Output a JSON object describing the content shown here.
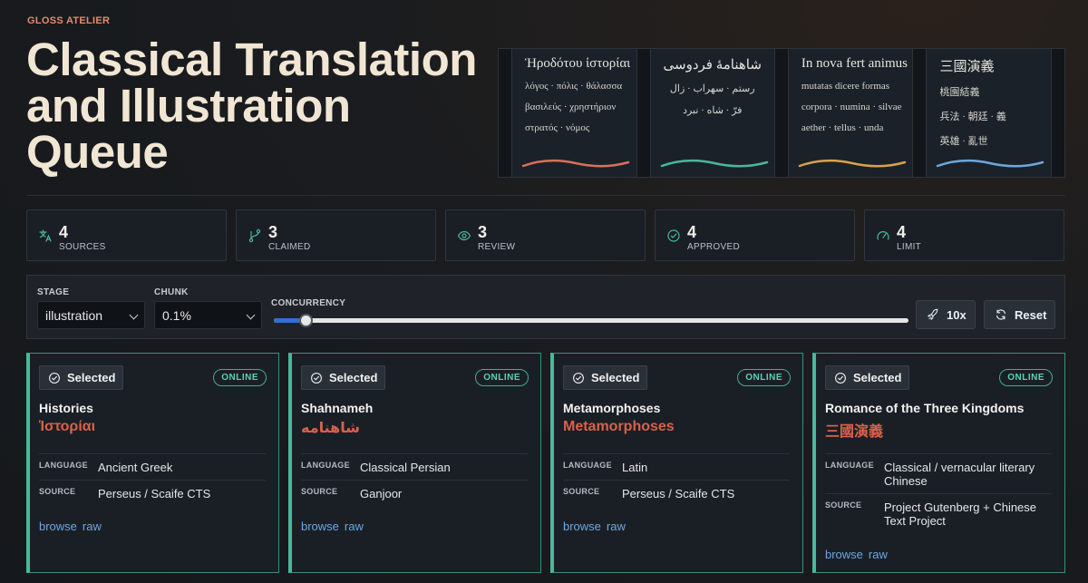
{
  "brand": "GLOSS ATELIER",
  "title": "Classical Translation and Illustration Queue",
  "hero_books": [
    {
      "title": "Ἡροδότου ἱστορίαι",
      "lines": [
        "λόγος · πόλις · θάλασσα",
        "βασιλεύς · χρηστήριον",
        "στρατός · νόμος"
      ],
      "color": "#d9705a",
      "rtl": false
    },
    {
      "title": "شاهنامهٔ فردوسی",
      "lines": [
        "رستم · سهراب · زال",
        "فرّ · شاه · نبرد"
      ],
      "color": "#4ab89a",
      "rtl": true
    },
    {
      "title": "In nova fert animus",
      "lines": [
        "mutatas dicere formas",
        "corpora · numina · silvae",
        "aether · tellus · unda"
      ],
      "color": "#d9a24a",
      "rtl": false
    },
    {
      "title": "三國演義",
      "lines": [
        "桃園結義",
        "兵法 · 朝廷 · 義",
        "英雄 · 亂世"
      ],
      "color": "#6ea7df",
      "rtl": false
    }
  ],
  "stats": [
    {
      "value": "4",
      "label": "SOURCES",
      "icon": "translate-icon"
    },
    {
      "value": "3",
      "label": "CLAIMED",
      "icon": "branch-icon"
    },
    {
      "value": "3",
      "label": "REVIEW",
      "icon": "eye-icon"
    },
    {
      "value": "4",
      "label": "APPROVED",
      "icon": "check-circle-icon"
    },
    {
      "value": "4",
      "label": "LIMIT",
      "icon": "gauge-icon"
    }
  ],
  "controls": {
    "stage_label": "STAGE",
    "stage_value": "illustration",
    "chunk_label": "CHUNK",
    "chunk_value": "0.1%",
    "concurrency_label": "CONCURRENCY",
    "concurrency_level": 0.05,
    "speed_label": "10x",
    "reset_label": "Reset"
  },
  "cards": [
    {
      "selected": "Selected",
      "status": "ONLINE",
      "title": "Histories",
      "original": "Ἱστορίαι",
      "language_key": "LANGUAGE",
      "language": "Ancient Greek",
      "source_key": "SOURCE",
      "source": "Perseus / Scaife CTS",
      "browse": "browse",
      "raw": "raw"
    },
    {
      "selected": "Selected",
      "status": "ONLINE",
      "title": "Shahnameh",
      "original": "شاهنامه",
      "language_key": "LANGUAGE",
      "language": "Classical Persian",
      "source_key": "SOURCE",
      "source": "Ganjoor",
      "browse": "browse",
      "raw": "raw"
    },
    {
      "selected": "Selected",
      "status": "ONLINE",
      "title": "Metamorphoses",
      "original": "Metamorphoses",
      "language_key": "LANGUAGE",
      "language": "Latin",
      "source_key": "SOURCE",
      "source": "Perseus / Scaife CTS",
      "browse": "browse",
      "raw": "raw"
    },
    {
      "selected": "Selected",
      "status": "ONLINE",
      "title": "Romance of the Three Kingdoms",
      "original": "三國演義",
      "language_key": "LANGUAGE",
      "language": "Classical / vernacular literary Chinese",
      "source_key": "SOURCE",
      "source": "Project Gutenberg + Chinese Text Project",
      "browse": "browse",
      "raw": "raw"
    }
  ]
}
